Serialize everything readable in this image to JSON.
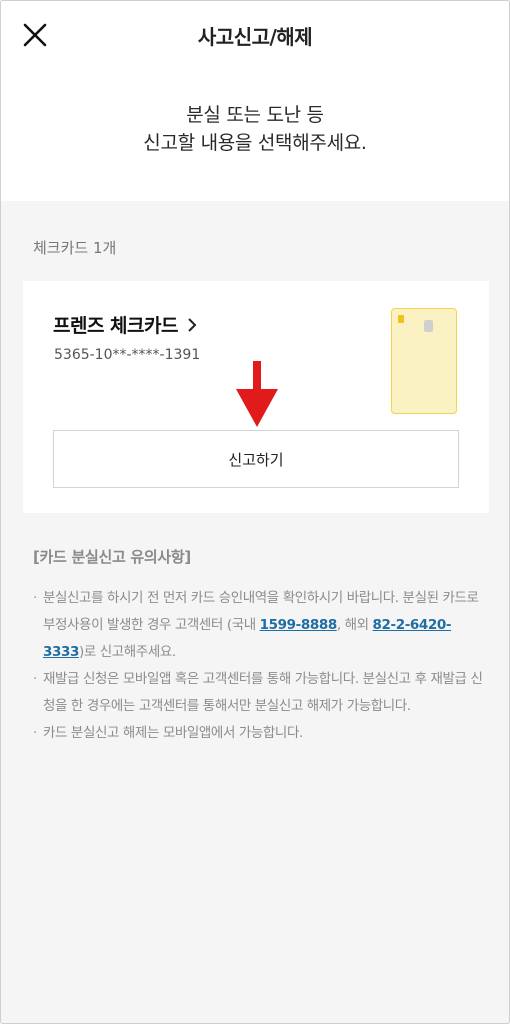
{
  "header": {
    "title": "사고신고/해제",
    "subtitle_line1": "분실 또는 도난 등",
    "subtitle_line2": "신고할 내용을 선택해주세요."
  },
  "section": {
    "label": "체크카드 1개"
  },
  "card": {
    "name": "프렌즈 체크카드",
    "number": "5365-10**-****-1391",
    "report_button_label": "신고하기"
  },
  "notice": {
    "title": "[카드 분실신고 유의사항]",
    "item1_part1": "분실신고를 하시기 전 먼저 카드 승인내역을 확인하시기 바랍니다. 분실된 카드로 부정사용이 발생한 경우 고객센터 (국내 ",
    "domestic_phone": "1599-8888",
    "item1_part2": ", 해외 ",
    "overseas_phone": "82-2-6420-3333",
    "item1_part3": ")로 신고해주세요.",
    "item2": "재발급 신청은 모바일앱 혹은 고객센터를 통해 가능합니다. 분실신고 후 재발급 신청을 한 경우에는 고객센터를 통해서만 분실신고 해제가 가능합니다.",
    "item3": "카드 분실신고 해제는 모바일앱에서 가능합니다."
  },
  "icons": {
    "close": "close-icon",
    "chevron": "chevron-right-icon",
    "arrow": "arrow-down-icon",
    "card": "card-image"
  },
  "colors": {
    "link": "#1f6ea3",
    "arrow": "#e11b1b",
    "card_fill": "#fbf2c4",
    "card_border": "#f1d54a"
  }
}
